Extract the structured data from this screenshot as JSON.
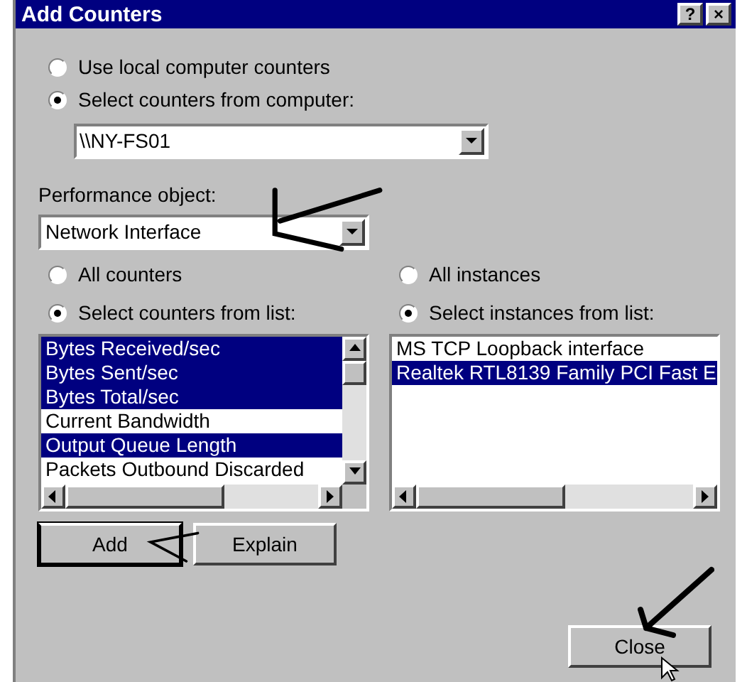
{
  "window": {
    "title": "Add Counters",
    "title_buttons": [
      "?",
      "×"
    ]
  },
  "computer_radios": [
    {
      "label": "Use local computer counters",
      "selected": false
    },
    {
      "label": "Select counters from computer:",
      "selected": true
    }
  ],
  "computer": {
    "value": "\\\\NY-FS01"
  },
  "performance_object": {
    "label": "Performance object:",
    "value": "Network Interface"
  },
  "counters": {
    "radios": [
      {
        "label": "All counters",
        "selected": false
      },
      {
        "label": "Select counters from list:",
        "selected": true
      }
    ],
    "items": [
      {
        "label": "Bytes Received/sec",
        "selected": true
      },
      {
        "label": "Bytes Sent/sec",
        "selected": true
      },
      {
        "label": "Bytes Total/sec",
        "selected": true
      },
      {
        "label": "Current Bandwidth",
        "selected": false
      },
      {
        "label": "Output Queue Length",
        "selected": true
      },
      {
        "label": "Packets Outbound Discarded",
        "selected": false
      }
    ]
  },
  "instances": {
    "radios": [
      {
        "label": "All instances",
        "selected": false
      },
      {
        "label": "Select instances from list:",
        "selected": true
      }
    ],
    "items": [
      {
        "label": "MS TCP Loopback interface",
        "selected": false
      },
      {
        "label": "Realtek RTL8139 Family PCI Fast E",
        "selected": true
      }
    ]
  },
  "buttons": [
    "Add",
    "Explain"
  ],
  "close_button": "Close"
}
